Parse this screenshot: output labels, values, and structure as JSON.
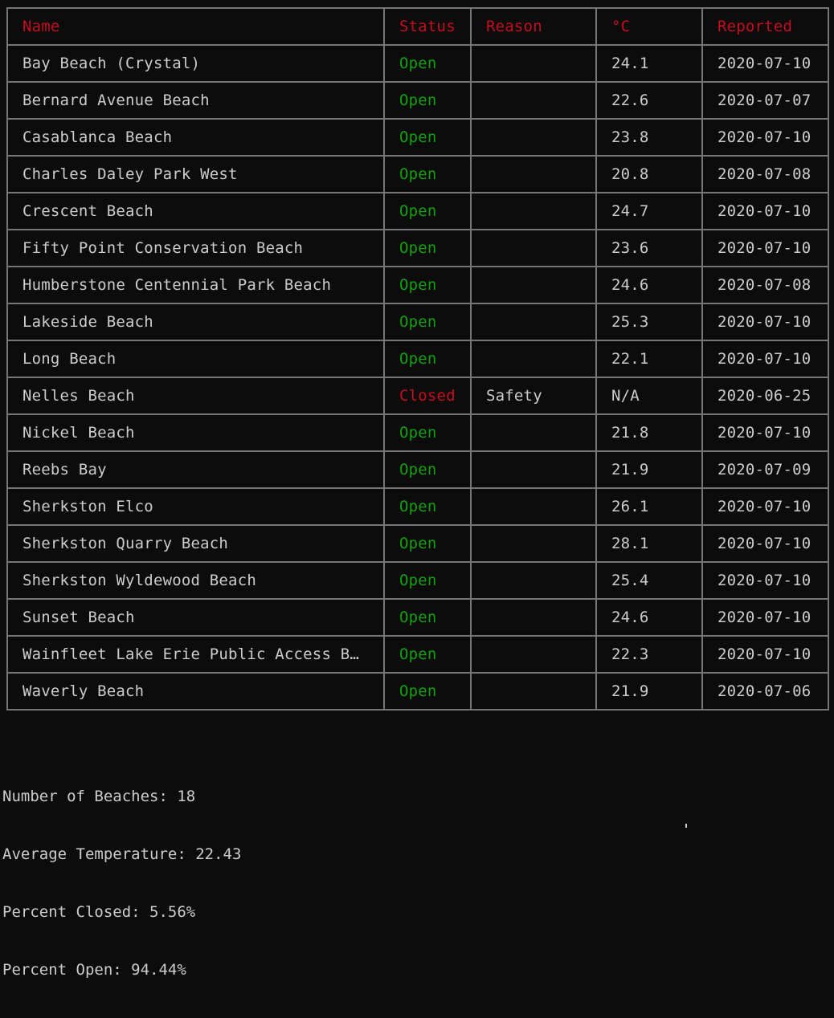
{
  "table": {
    "headers": {
      "name": "Name",
      "status": "Status",
      "reason": "Reason",
      "temp": "°C",
      "reported": "Reported"
    },
    "rows": [
      {
        "name": "Bay Beach (Crystal)",
        "status": "Open",
        "reason": "",
        "temp": "24.1",
        "reported": "2020-07-10"
      },
      {
        "name": "Bernard Avenue Beach",
        "status": "Open",
        "reason": "",
        "temp": "22.6",
        "reported": "2020-07-07"
      },
      {
        "name": "Casablanca Beach",
        "status": "Open",
        "reason": "",
        "temp": "23.8",
        "reported": "2020-07-10"
      },
      {
        "name": "Charles Daley Park West",
        "status": "Open",
        "reason": "",
        "temp": "20.8",
        "reported": "2020-07-08"
      },
      {
        "name": "Crescent Beach",
        "status": "Open",
        "reason": "",
        "temp": "24.7",
        "reported": "2020-07-10"
      },
      {
        "name": "Fifty Point Conservation Beach",
        "status": "Open",
        "reason": "",
        "temp": "23.6",
        "reported": "2020-07-10"
      },
      {
        "name": "Humberstone Centennial Park Beach",
        "status": "Open",
        "reason": "",
        "temp": "24.6",
        "reported": "2020-07-08"
      },
      {
        "name": "Lakeside Beach",
        "status": "Open",
        "reason": "",
        "temp": "25.3",
        "reported": "2020-07-10"
      },
      {
        "name": "Long Beach",
        "status": "Open",
        "reason": "",
        "temp": "22.1",
        "reported": "2020-07-10"
      },
      {
        "name": "Nelles Beach",
        "status": "Closed",
        "reason": "Safety",
        "temp": "N/A",
        "reported": "2020-06-25"
      },
      {
        "name": "Nickel Beach",
        "status": "Open",
        "reason": "",
        "temp": "21.8",
        "reported": "2020-07-10"
      },
      {
        "name": "Reebs Bay",
        "status": "Open",
        "reason": "",
        "temp": "21.9",
        "reported": "2020-07-09"
      },
      {
        "name": "Sherkston Elco",
        "status": "Open",
        "reason": "",
        "temp": "26.1",
        "reported": "2020-07-10"
      },
      {
        "name": "Sherkston Quarry Beach",
        "status": "Open",
        "reason": "",
        "temp": "28.1",
        "reported": "2020-07-10"
      },
      {
        "name": "Sherkston Wyldewood Beach",
        "status": "Open",
        "reason": "",
        "temp": "25.4",
        "reported": "2020-07-10"
      },
      {
        "name": "Sunset Beach",
        "status": "Open",
        "reason": "",
        "temp": "24.6",
        "reported": "2020-07-10"
      },
      {
        "name": "Wainfleet Lake Erie Public Access B…",
        "status": "Open",
        "reason": "",
        "temp": "22.3",
        "reported": "2020-07-10"
      },
      {
        "name": "Waverly Beach",
        "status": "Open",
        "reason": "",
        "temp": "21.9",
        "reported": "2020-07-06"
      }
    ]
  },
  "summary": {
    "count": "Number of Beaches: 18",
    "avg_temp": "Average Temperature: 22.43",
    "pct_closed": "Percent Closed: 5.56%",
    "pct_open": "Percent Open: 94.44%"
  },
  "colors": {
    "background": "#0c0c0c",
    "text": "#cccccc",
    "header": "#c50f1f",
    "open": "#13a10e",
    "closed": "#c50f1f",
    "border": "#767676"
  }
}
